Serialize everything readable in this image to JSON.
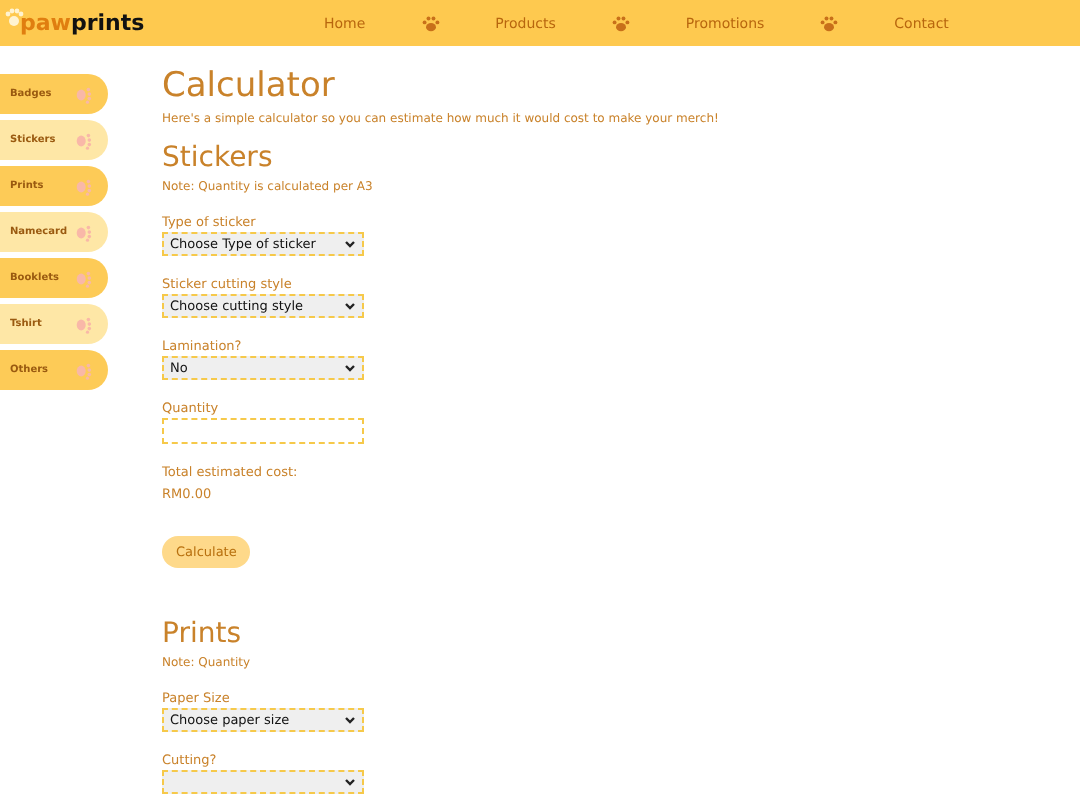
{
  "logo": {
    "part_1": "paw",
    "part_2": "prints"
  },
  "nav": [
    "Home",
    "Products",
    "Promotions",
    "Contact"
  ],
  "sidebar": {
    "items": [
      "Badges",
      "Stickers",
      "Prints",
      "Namecard",
      "Booklets",
      "Tshirt",
      "Others"
    ]
  },
  "title": "Calculator",
  "intro": "Here's a simple calculator so you can estimate how much it would cost to make your merch!",
  "sections": [
    {
      "heading": "Stickers",
      "note": "Note: Quantity is calculated per A3",
      "fields": [
        {
          "kind": "select",
          "label": "Type of sticker",
          "value": "Choose Type of sticker"
        },
        {
          "kind": "select",
          "label": "Sticker cutting style",
          "value": "Choose cutting style"
        },
        {
          "kind": "select",
          "label": "Lamination?",
          "value": "No"
        },
        {
          "kind": "input",
          "label": "Quantity"
        }
      ],
      "total_label": "Total estimated cost:",
      "total": "RM0.00",
      "button": "Calculate"
    },
    {
      "heading": "Prints",
      "note": "Note: Quantity",
      "fields": [
        {
          "kind": "select",
          "label": "Paper Size",
          "value": "Choose paper size"
        },
        {
          "kind": "select",
          "label": "Cutting?"
        }
      ]
    }
  ]
}
